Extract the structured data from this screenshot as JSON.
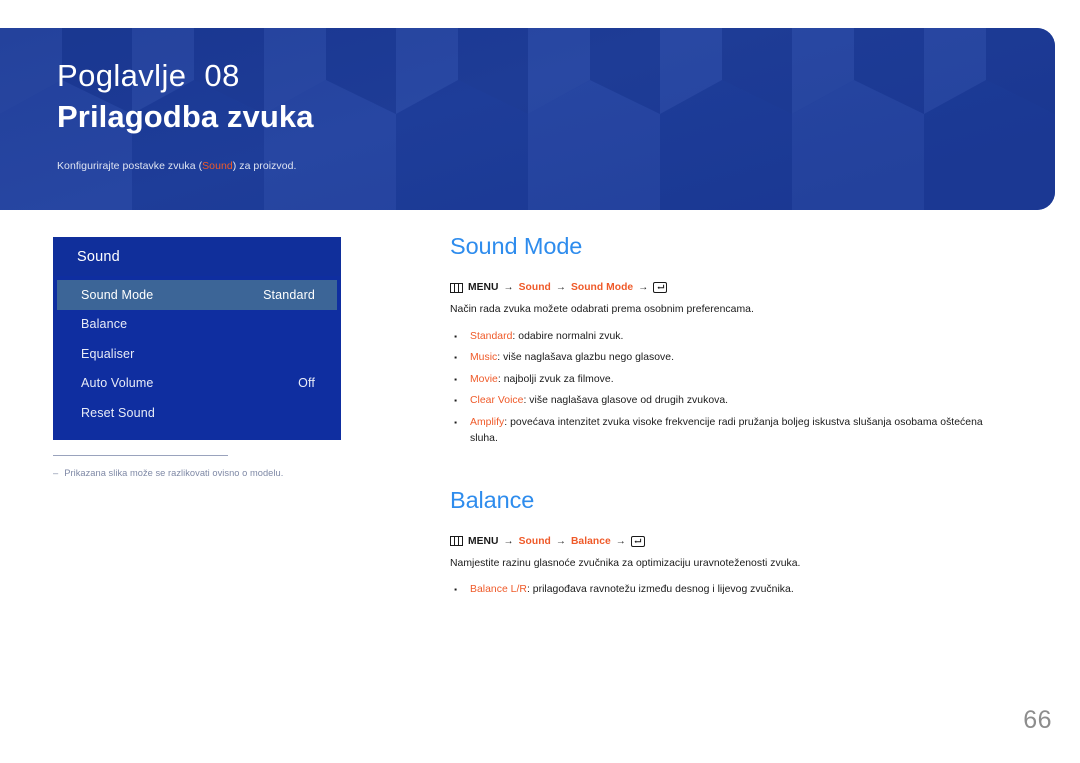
{
  "banner": {
    "chapter_label": "Poglavlje  08",
    "chapter_title": "Prilagodba zvuka",
    "subtitle_pre": "Konfigurirajte postavke zvuka (",
    "subtitle_accent": "Sound",
    "subtitle_post": ") za proizvod.",
    "bg_color": "#1d3d9c",
    "accent_color": "#ef5a29"
  },
  "osd": {
    "title": "Sound",
    "header_bg": "#102f9b",
    "body_bg": "#0f2ea0",
    "selected_bg": "#3c6597",
    "rows": [
      {
        "label": "Sound Mode",
        "value": "Standard",
        "selected": true
      },
      {
        "label": "Balance",
        "value": "",
        "selected": false
      },
      {
        "label": "Equaliser",
        "value": "",
        "selected": false
      },
      {
        "label": "Auto Volume",
        "value": "Off",
        "selected": false
      },
      {
        "label": "Reset Sound",
        "value": "",
        "selected": false
      }
    ]
  },
  "note": {
    "dash": "–",
    "text": "Prikazana slika može se razlikovati ovisno o modelu."
  },
  "sections": [
    {
      "title": "Sound Mode",
      "breadcrumb": {
        "menu_icon": "menu-icon",
        "menu_label": "MENU",
        "arrow": "→",
        "step1": "Sound",
        "step2": "Sound Mode",
        "enter_icon": "enter-key-icon"
      },
      "body": "Način rada zvuka možete odabrati prema osobnim preferencama.",
      "bullets": [
        {
          "dot": "▪",
          "term": "Standard",
          "rest": ": odabire normalni zvuk."
        },
        {
          "dot": "▪",
          "term": "Music",
          "rest": ": više naglašava glazbu nego glasove."
        },
        {
          "dot": "▪",
          "term": "Movie",
          "rest": ": najbolji zvuk za filmove."
        },
        {
          "dot": "▪",
          "term": "Clear Voice",
          "rest": ": više naglašava glasove od drugih zvukova."
        },
        {
          "dot": "▪",
          "term": "Amplify",
          "rest": ": povećava intenzitet zvuka visoke frekvencije radi pružanja boljeg iskustva slušanja osobama oštećena sluha."
        }
      ]
    },
    {
      "title": "Balance",
      "breadcrumb": {
        "menu_icon": "menu-icon",
        "menu_label": "MENU",
        "arrow": "→",
        "step1": "Sound",
        "step2": "Balance",
        "enter_icon": "enter-key-icon"
      },
      "body": "Namjestite razinu glasnoće zvučnika za optimizaciju uravnoteženosti zvuka.",
      "bullets": [
        {
          "dot": "▪",
          "term": "Balance L/R",
          "rest": ": prilagođava ravnotežu između desnog i lijevog zvučnika."
        }
      ]
    }
  ],
  "page_number": "66"
}
